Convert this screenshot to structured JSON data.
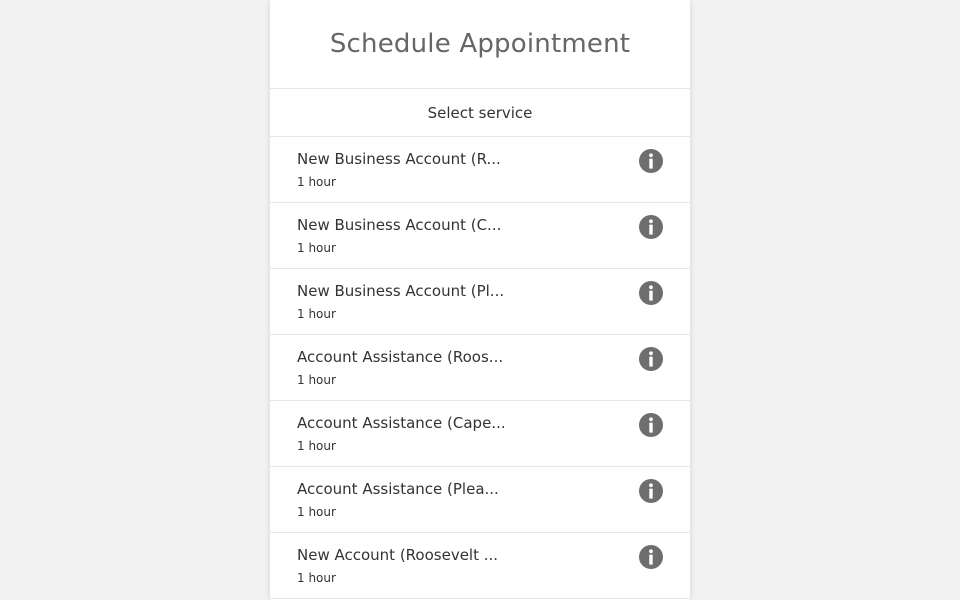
{
  "header": {
    "title": "Schedule Appointment"
  },
  "subheader": {
    "label": "Select service"
  },
  "icons": {
    "info": "info-circle-icon"
  },
  "colors": {
    "icon": "#6e6e6e",
    "text": "#333333",
    "title": "#666666",
    "background": "#f2f2f2"
  },
  "services": [
    {
      "title": "New Business Account (R...",
      "duration": "1 hour"
    },
    {
      "title": "New Business Account (C...",
      "duration": "1 hour"
    },
    {
      "title": "New Business Account (Pl...",
      "duration": "1 hour"
    },
    {
      "title": "Account Assistance (Roos...",
      "duration": "1 hour"
    },
    {
      "title": "Account Assistance (Cape...",
      "duration": "1 hour"
    },
    {
      "title": "Account Assistance (Plea...",
      "duration": "1 hour"
    },
    {
      "title": "New Account (Roosevelt ...",
      "duration": "1 hour"
    }
  ]
}
